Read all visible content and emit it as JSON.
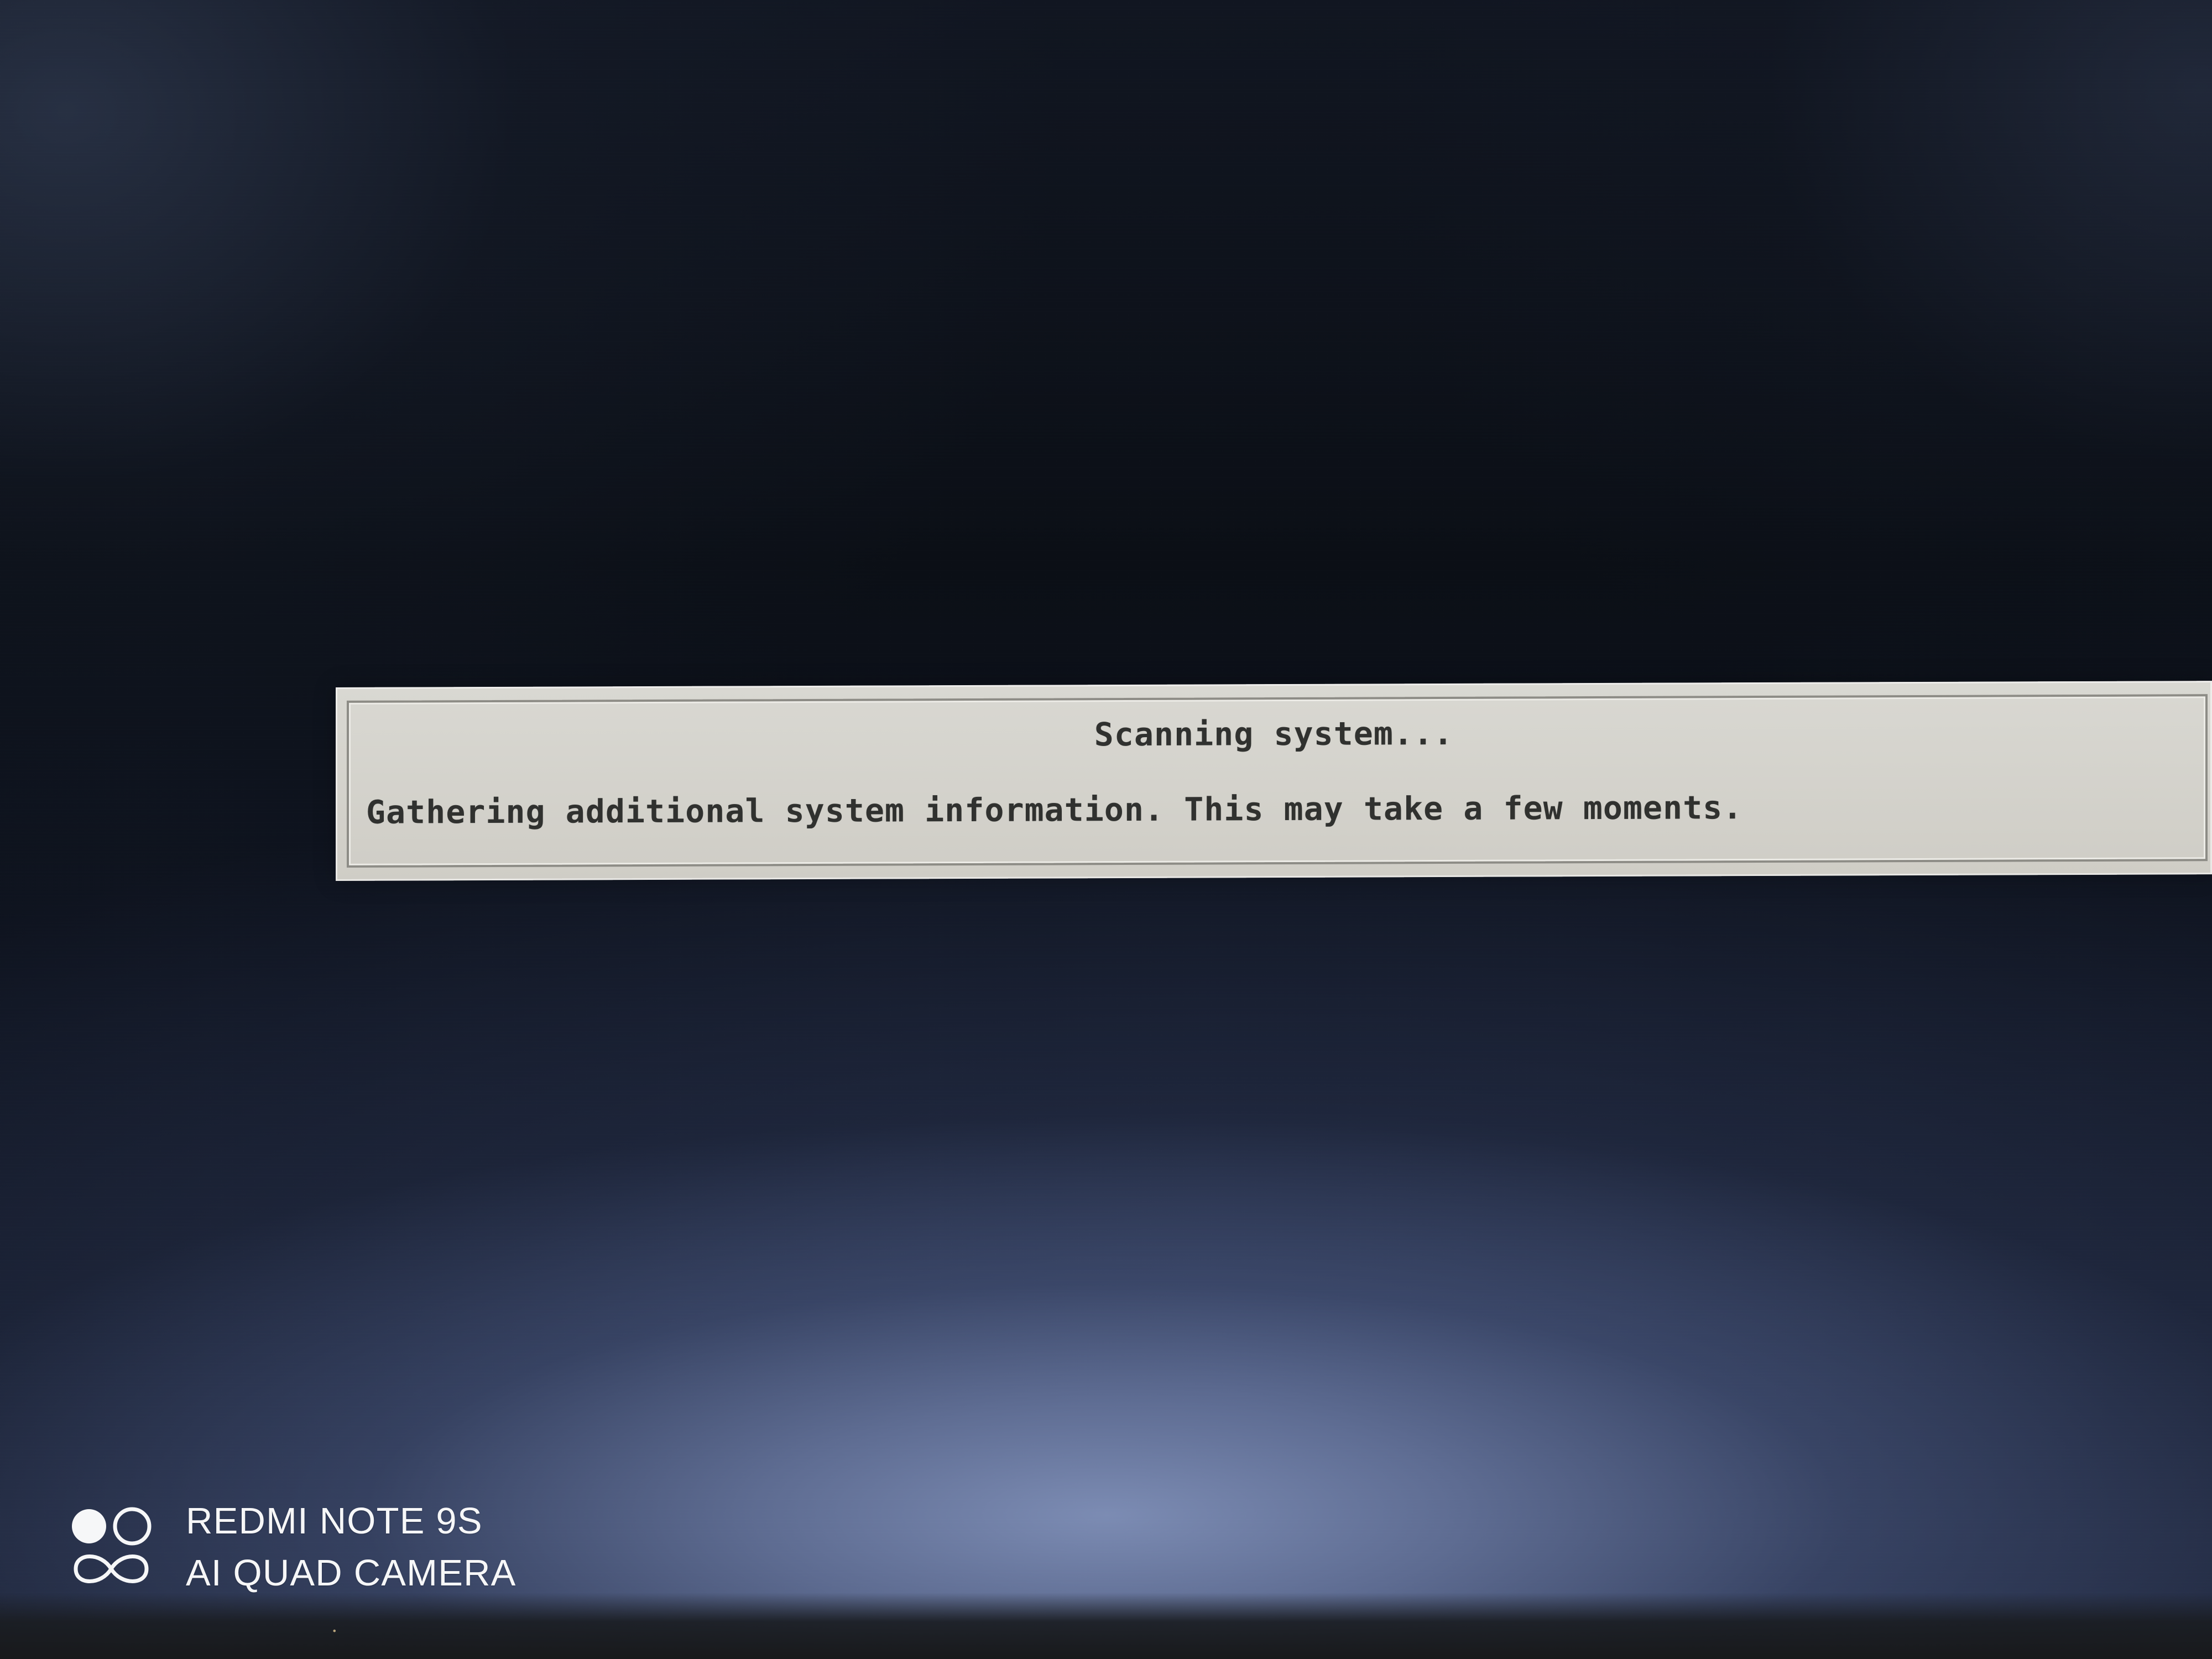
{
  "dialog": {
    "title": "Scanning system...",
    "message": "Gathering additional system information. This may take a few moments."
  },
  "watermark": {
    "icon": "redmi-camera-logo-icon",
    "line1": "REDMI NOTE 9S",
    "line2": "AI QUAD CAMERA"
  },
  "colors": {
    "dialog_background": "#d6d4cd",
    "dialog_text": "#30312f",
    "screen_background": "#0d1017"
  }
}
